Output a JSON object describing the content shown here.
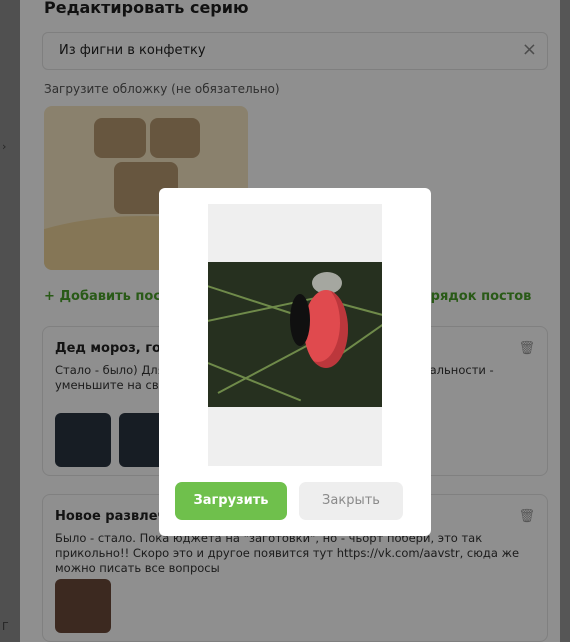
{
  "panel": {
    "title": "Редактировать серию",
    "series_name": "Из фигни в конфетку",
    "clear_icon": "close-icon",
    "cover_label": "Загрузите обложку (не обязательно)",
    "add_post_label": "Добавить пост",
    "order_posts_label": "ь порядок постов"
  },
  "cards": [
    {
      "title": "Дед мороз, готов",
      "text": "Стало - было) Для фото. @sttaya, , вы хотели увидеть ит в реальности - уменьшите на свое ем и посмотрите...",
      "thumbs": 2
    },
    {
      "title": "Новое развлечен",
      "text": "Было - стало. Пока юджета на \"заготовки\", но - чьорт побери, это так прикольно!! Скоро это и другое появится тут https://vk.com/aavstr, сюда же можно писать все вопросы",
      "thumbs": 1
    }
  ],
  "modal": {
    "upload_label": "Загрузить",
    "close_label": "Закрыть"
  },
  "colors": {
    "accent_green": "#6fc04c",
    "link_green": "#4aa02a",
    "bauble_red": "#e04a4e"
  }
}
